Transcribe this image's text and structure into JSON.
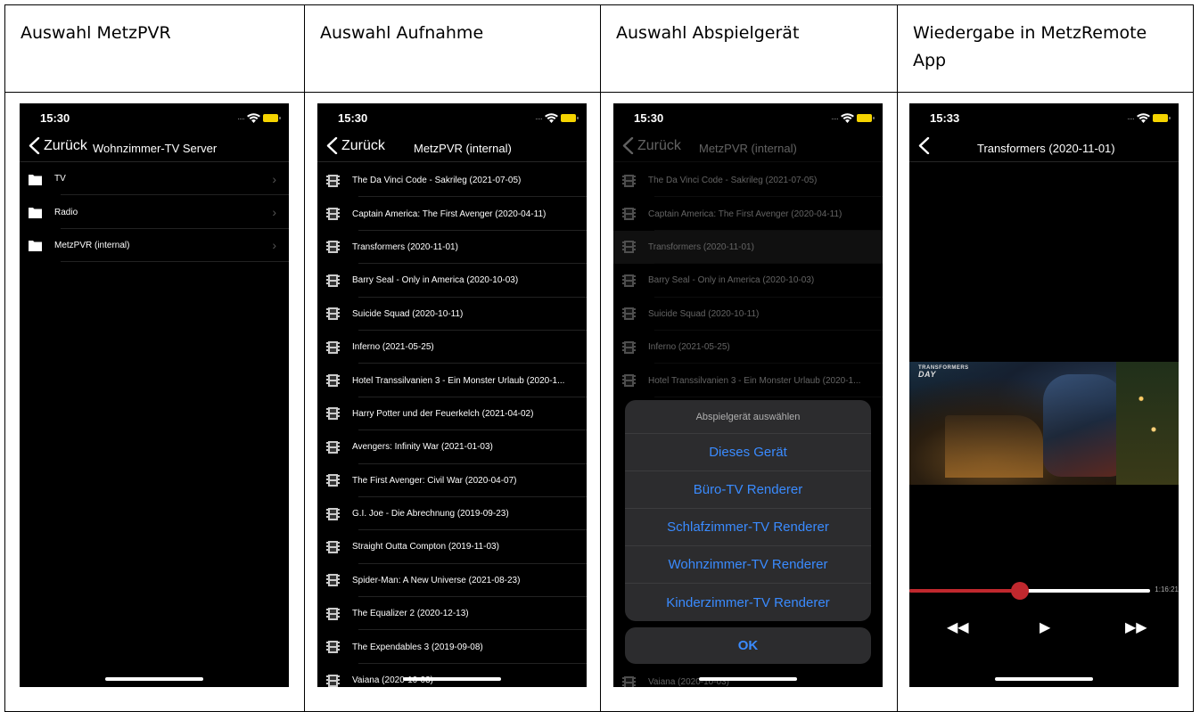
{
  "headers": [
    "Auswahl MetzPVR",
    "Auswahl Aufnahme",
    "Auswahl Abspielgerät",
    "Wiedergabe in MetzRemote App"
  ],
  "phone1": {
    "time": "15:30",
    "back_label": "Zurück",
    "title": "Wohnzimmer-TV Server",
    "items": [
      {
        "label": "TV"
      },
      {
        "label": "Radio"
      },
      {
        "label": "MetzPVR (internal)"
      }
    ]
  },
  "phone2": {
    "time": "15:30",
    "back_label": "Zurück",
    "title": "MetzPVR (internal)",
    "items": [
      "The Da Vinci Code - Sakrileg (2021-07-05)",
      "Captain America: The First Avenger (2020-04-11)",
      "Transformers (2020-11-01)",
      "Barry Seal - Only in America (2020-10-03)",
      "Suicide Squad (2020-10-11)",
      "Inferno (2021-05-25)",
      "Hotel Transsilvanien 3 - Ein Monster Urlaub (2020-1...",
      "Harry Potter und der Feuerkelch (2021-04-02)",
      "Avengers: Infinity War (2021-01-03)",
      "The First Avenger: Civil War (2020-04-07)",
      "G.I. Joe - Die Abrechnung (2019-09-23)",
      "Straight Outta Compton (2019-11-03)",
      "Spider-Man: A New Universe (2021-08-23)",
      "The Equalizer 2 (2020-12-13)",
      "The Expendables 3 (2019-09-08)",
      "Vaiana (2020-10-03)"
    ]
  },
  "phone3": {
    "time": "15:30",
    "back_label": "Zurück",
    "title": "MetzPVR (internal)",
    "items": [
      "The Da Vinci Code - Sakrileg (2021-07-05)",
      "Captain America: The First Avenger (2020-04-11)",
      "Transformers (2020-11-01)",
      "Barry Seal - Only in America (2020-10-03)",
      "Suicide Squad (2020-10-11)",
      "Inferno (2021-05-25)",
      "Hotel Transsilvanien 3 - Ein Monster Urlaub (2020-1..."
    ],
    "last_item": "Vaiana (2020-10-03)",
    "sheet_title": "Abspielgerät auswählen",
    "options": [
      "Dieses Gerät",
      "Büro-TV Renderer",
      "Schlafzimmer-TV Renderer",
      "Wohnzimmer-TV Renderer",
      "Kinderzimmer-TV Renderer"
    ],
    "ok_label": "OK"
  },
  "phone4": {
    "time": "15:33",
    "title": "Transformers (2020-11-01)",
    "video_logo_top": "TRANSFORMERS",
    "video_logo_bottom": "DAY",
    "duration": "1:16:21",
    "progress_fraction": 0.46,
    "rewind_icon": "◀◀",
    "play_icon": "▶",
    "forward_icon": "▶▶"
  },
  "colors": {
    "accent": "#3a8bff",
    "progress": "#c0282e",
    "battery": "#f5d400"
  }
}
